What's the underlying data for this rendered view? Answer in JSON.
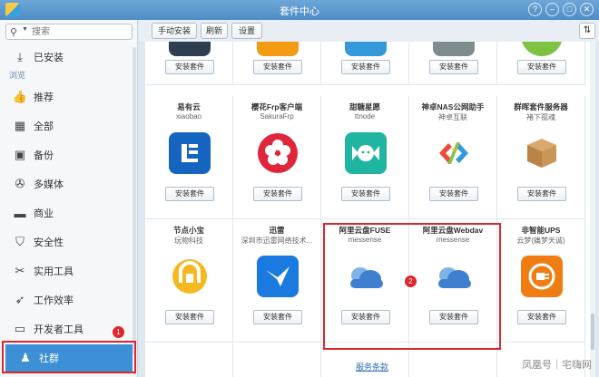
{
  "window": {
    "title": "套件中心",
    "controls": [
      "?",
      "–",
      "□",
      "✕"
    ]
  },
  "sidebar": {
    "search_placeholder": "搜索",
    "installed": "已安装",
    "section": "浏览",
    "items": [
      "推荐",
      "全部",
      "备份",
      "多媒体",
      "商业",
      "安全性",
      "实用工具",
      "工作效率",
      "开发者工具",
      "社群"
    ],
    "active": "社群"
  },
  "toolbar": {
    "manual_install": "手动安装",
    "refresh": "刷新",
    "settings": "设置"
  },
  "install_label": "安装套件",
  "rows": [
    [
      {
        "name": "易有云",
        "vendor": "xiaobao",
        "icon": "yiyouyun-icon"
      },
      {
        "name": "樱花Frp客户端",
        "vendor": "SakuraFrp",
        "icon": "sakura-icon"
      },
      {
        "name": "甜糖星愿",
        "vendor": "ttnode",
        "icon": "candy-icon"
      },
      {
        "name": "神卓NAS公网助手",
        "vendor": "神卓互联",
        "icon": "shenzhuo-icon"
      },
      {
        "name": "群晖套件服务器",
        "vendor": "褚下孤魂",
        "icon": "package-box-icon"
      }
    ],
    [
      {
        "name": "节点小宝",
        "vendor": "玩物科技",
        "icon": "node-icon"
      },
      {
        "name": "迅雷",
        "vendor": "深圳市迅雷网络技术...",
        "icon": "xunlei-icon"
      },
      {
        "name": "阿里云盘FUSE",
        "vendor": "messense",
        "icon": "cloud-icon"
      },
      {
        "name": "阿里云盘Webdav",
        "vendor": "messense",
        "icon": "cloud-icon"
      },
      {
        "name": "非智能UPS",
        "vendor": "云梦(痛梦天诚)",
        "icon": "ups-plug-icon"
      }
    ]
  ],
  "badges": [
    "1",
    "2"
  ],
  "terms_link": "服务条款",
  "watermark": "凤凰号｜宅嗨网"
}
